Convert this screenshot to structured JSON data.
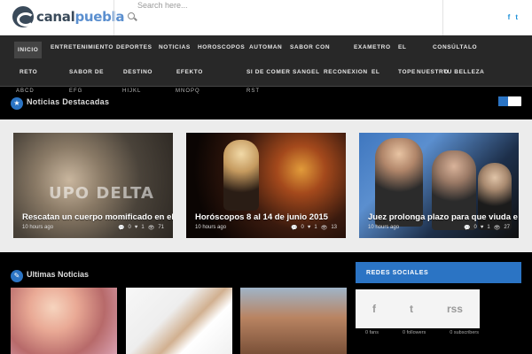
{
  "header": {
    "logo_prefix": "canal",
    "logo_suffix": "puebla",
    "search_placeholder": "Search here...",
    "social": [
      "f",
      "t"
    ]
  },
  "nav": {
    "row1": [
      "INICIO",
      "ENTRETENIMIENTO",
      "DEPORTES",
      "NOTICIAS",
      "HOROSCOPOS",
      "AUTOMAN",
      "SABOR CON",
      "EXAMETRO",
      "EL",
      "CONSÚLTALO"
    ],
    "row2": [
      "RETO",
      "SABOR DE",
      "DESTINO",
      "EFEKTO",
      "SI DE COMER SANGEL",
      "RECONEXION",
      "EL",
      "TOPE",
      "NUESTRO",
      "TU BELLEZA"
    ]
  },
  "ribbon": {
    "title": "Noticias Destacadas",
    "labels": [
      "ABCD",
      "EFG",
      "HIJKL",
      "MNOPQ",
      "RST"
    ]
  },
  "featured": [
    {
      "title": "Rescatan un cuerpo momificado en el",
      "time": "10 hours ago",
      "comments": "0",
      "likes": "1",
      "views": "71",
      "watermark": "UPO DELTA"
    },
    {
      "title": "Horóscopos 8 al 14 de junio 2015",
      "time": "10 hours ago",
      "comments": "0",
      "likes": "1",
      "views": "13"
    },
    {
      "title": "Juez prolonga plazo para que viuda e",
      "time": "10 hours ago",
      "comments": "0",
      "likes": "1",
      "views": "27"
    }
  ],
  "lower": {
    "section_title": "Ultimas Noticias",
    "redes_title": "REDES SOCIALES",
    "social_icons": [
      "f",
      "t",
      "rss"
    ],
    "social_counts": [
      "0 fans",
      "0 followers",
      "0 subscribers"
    ]
  },
  "colors": {
    "accent": "#2b74c4",
    "nav_bg": "#282828",
    "featured_bg": "#ececec"
  }
}
